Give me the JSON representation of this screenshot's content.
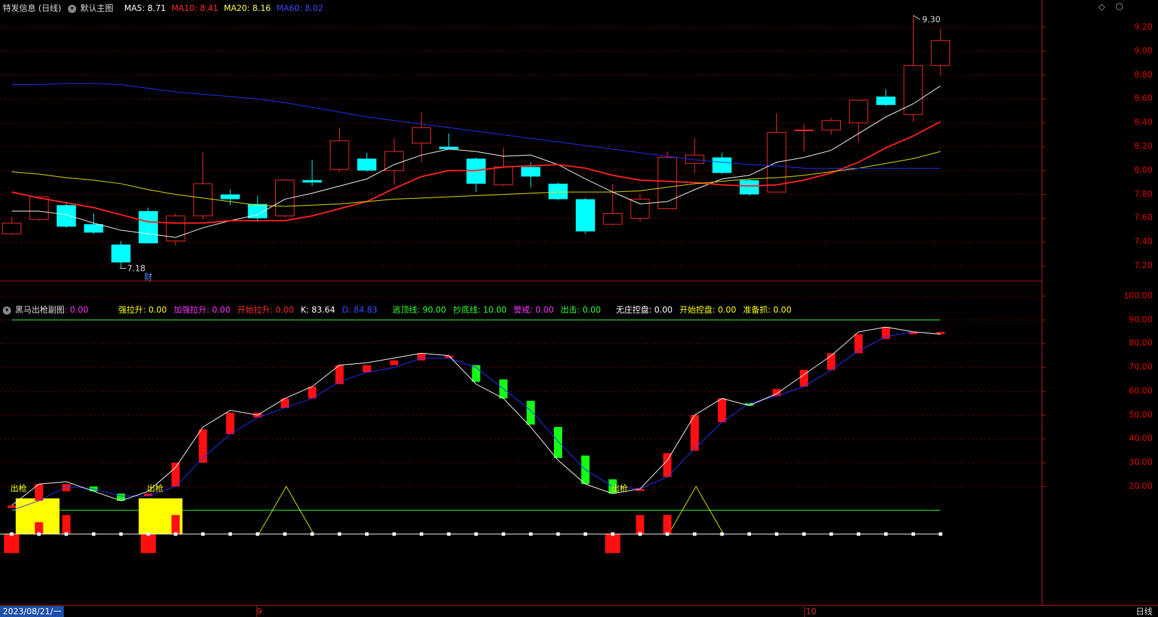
{
  "main_header": {
    "stock_name": "特发信息 (日线)",
    "chart_title": "默认主图",
    "indicators": [
      {
        "label": "MA5: ",
        "value": "8.71",
        "color": "#ffffff"
      },
      {
        "label": "MA10: ",
        "value": "8.41",
        "color": "#ff2a2a"
      },
      {
        "label": "MA20: ",
        "value": "8.16",
        "color": "#ffff55"
      },
      {
        "label": "MA60: ",
        "value": "8.02",
        "color": "#3b4bff"
      }
    ]
  },
  "sub_header": {
    "title": "黑马出枪副图",
    "title_value": ": 0.00",
    "title_value_color": "#ff33ff",
    "items": [
      {
        "label": "强拉升: ",
        "value": "0.00",
        "color": "#ffff00"
      },
      {
        "label": "加强拉升: ",
        "value": "0.00",
        "color": "#ff33ff"
      },
      {
        "label": "开始拉升: ",
        "value": "0.00",
        "color": "#ff2a2a"
      },
      {
        "label": "K: ",
        "value": "83.64",
        "color": "#ffffff"
      },
      {
        "label": "D: ",
        "value": "84.83",
        "color": "#3b4bff"
      },
      {
        "label": "逃顶线: ",
        "value": "90.00",
        "color": "#33ff33"
      },
      {
        "label": "抄底线: ",
        "value": "10.00",
        "color": "#33ff33"
      },
      {
        "label": "警戒: ",
        "value": "0.00",
        "color": "#ff33ff"
      },
      {
        "label": "出击: ",
        "value": "0.00",
        "color": "#33ff33"
      },
      {
        "label": "无庄控盘: ",
        "value": "0.00",
        "color": "#ffffff"
      },
      {
        "label": "开始控盘: ",
        "value": "0.00",
        "color": "#ffff00"
      },
      {
        "label": "准备抓: ",
        "value": "0.00",
        "color": "#ffff00"
      }
    ]
  },
  "main_axis": [
    "9.20",
    "9.00",
    "8.80",
    "8.60",
    "8.40",
    "8.20",
    "8.00",
    "7.80",
    "7.60",
    "7.40",
    "7.20"
  ],
  "sub_axis": [
    "100.00",
    "90.00",
    "80.00",
    "70.00",
    "60.00",
    "50.00",
    "40.00",
    "30.00",
    "20.00"
  ],
  "annotations": {
    "high_label": "9.30",
    "low_label": "7.18",
    "finance_marker": "财",
    "signal_label": "出枪"
  },
  "bottom_bar": {
    "date": "2023/08/21/一",
    "month_labels": [
      "9",
      "10"
    ],
    "period_button": "日线"
  },
  "colors": {
    "up": "#ff2a2a",
    "down": "#00ffff",
    "ma5": "#ffffff",
    "ma10": "#ff2020",
    "ma20": "#e6e600",
    "ma60": "#2233ff",
    "kline": "#ffffff",
    "dline": "#2233ff",
    "limit_lines": "#33ff33",
    "grid": "#8a0000"
  },
  "chart_data": [
    {
      "type": "candlestick",
      "title": "默认主图",
      "ylim": [
        7.12,
        9.3
      ],
      "candles": [
        {
          "o": 7.47,
          "h": 7.61,
          "l": 7.46,
          "c": 7.56
        },
        {
          "o": 7.59,
          "h": 7.78,
          "l": 7.58,
          "c": 7.78
        },
        {
          "o": 7.71,
          "h": 7.74,
          "l": 7.52,
          "c": 7.53
        },
        {
          "o": 7.55,
          "h": 7.64,
          "l": 7.47,
          "c": 7.48
        },
        {
          "o": 7.38,
          "h": 7.41,
          "l": 7.18,
          "c": 7.23
        },
        {
          "o": 7.66,
          "h": 7.69,
          "l": 7.39,
          "c": 7.39
        },
        {
          "o": 7.41,
          "h": 7.64,
          "l": 7.37,
          "c": 7.62
        },
        {
          "o": 7.62,
          "h": 8.15,
          "l": 7.59,
          "c": 7.89
        },
        {
          "o": 7.8,
          "h": 7.84,
          "l": 7.71,
          "c": 7.76
        },
        {
          "o": 7.72,
          "h": 7.79,
          "l": 7.57,
          "c": 7.6
        },
        {
          "o": 7.62,
          "h": 7.93,
          "l": 7.61,
          "c": 7.92
        },
        {
          "o": 7.92,
          "h": 8.09,
          "l": 7.87,
          "c": 7.9
        },
        {
          "o": 8.01,
          "h": 8.36,
          "l": 7.99,
          "c": 8.25
        },
        {
          "o": 8.1,
          "h": 8.15,
          "l": 7.99,
          "c": 8.0
        },
        {
          "o": 8.0,
          "h": 8.27,
          "l": 7.88,
          "c": 8.16
        },
        {
          "o": 8.23,
          "h": 8.49,
          "l": 8.07,
          "c": 8.36
        },
        {
          "o": 8.2,
          "h": 8.31,
          "l": 8.18,
          "c": 8.18
        },
        {
          "o": 8.1,
          "h": 8.11,
          "l": 7.82,
          "c": 7.89
        },
        {
          "o": 7.88,
          "h": 8.19,
          "l": 7.87,
          "c": 8.03
        },
        {
          "o": 8.03,
          "h": 8.07,
          "l": 7.86,
          "c": 7.95
        },
        {
          "o": 7.89,
          "h": 7.9,
          "l": 7.75,
          "c": 7.76
        },
        {
          "o": 7.76,
          "h": 7.77,
          "l": 7.47,
          "c": 7.49
        },
        {
          "o": 7.55,
          "h": 7.89,
          "l": 7.54,
          "c": 7.64
        },
        {
          "o": 7.6,
          "h": 7.8,
          "l": 7.57,
          "c": 7.76
        },
        {
          "o": 7.68,
          "h": 8.16,
          "l": 7.68,
          "c": 8.11
        },
        {
          "o": 8.06,
          "h": 8.27,
          "l": 7.98,
          "c": 8.13
        },
        {
          "o": 8.11,
          "h": 8.15,
          "l": 7.97,
          "c": 7.98
        },
        {
          "o": 7.92,
          "h": 7.93,
          "l": 7.79,
          "c": 7.8
        },
        {
          "o": 7.82,
          "h": 8.48,
          "l": 7.82,
          "c": 8.32
        },
        {
          "o": 8.34,
          "h": 8.39,
          "l": 8.16,
          "c": 8.34
        },
        {
          "o": 8.34,
          "h": 8.44,
          "l": 8.3,
          "c": 8.42
        },
        {
          "o": 8.4,
          "h": 8.59,
          "l": 8.24,
          "c": 8.59
        },
        {
          "o": 8.62,
          "h": 8.68,
          "l": 8.54,
          "c": 8.55
        },
        {
          "o": 8.47,
          "h": 9.3,
          "l": 8.41,
          "c": 8.88
        },
        {
          "o": 8.88,
          "h": 9.19,
          "l": 8.8,
          "c": 9.09
        }
      ],
      "ma_series": [
        {
          "name": "MA5",
          "values": [
            7.66,
            7.66,
            7.63,
            7.56,
            7.5,
            7.47,
            7.44,
            7.52,
            7.58,
            7.63,
            7.76,
            7.81,
            7.87,
            7.93,
            8.05,
            8.13,
            8.18,
            8.16,
            8.12,
            8.13,
            8.05,
            7.93,
            7.82,
            7.72,
            7.74,
            7.84,
            7.93,
            7.96,
            8.07,
            8.11,
            8.17,
            8.31,
            8.45,
            8.56,
            8.71
          ]
        },
        {
          "name": "MA10",
          "values": [
            7.82,
            7.77,
            7.73,
            7.69,
            7.63,
            7.57,
            7.56,
            7.56,
            7.58,
            7.58,
            7.58,
            7.62,
            7.68,
            7.74,
            7.85,
            7.95,
            8.0,
            8.0,
            8.03,
            8.04,
            8.05,
            8.02,
            7.96,
            7.92,
            7.91,
            7.9,
            7.88,
            7.87,
            7.88,
            7.92,
            7.98,
            8.07,
            8.19,
            8.29,
            8.41
          ]
        },
        {
          "name": "MA20",
          "values": [
            7.99,
            7.97,
            7.94,
            7.92,
            7.89,
            7.84,
            7.8,
            7.77,
            7.74,
            7.71,
            7.7,
            7.71,
            7.72,
            7.74,
            7.76,
            7.77,
            7.78,
            7.79,
            7.8,
            7.81,
            7.82,
            7.82,
            7.82,
            7.83,
            7.86,
            7.89,
            7.91,
            7.93,
            7.94,
            7.96,
            7.99,
            8.02,
            8.06,
            8.1,
            8.16
          ]
        },
        {
          "name": "MA60",
          "values": [
            8.72,
            8.72,
            8.73,
            8.73,
            8.72,
            8.69,
            8.66,
            8.64,
            8.62,
            8.6,
            8.57,
            8.53,
            8.49,
            8.45,
            8.42,
            8.39,
            8.36,
            8.33,
            8.3,
            8.27,
            8.24,
            8.21,
            8.18,
            8.15,
            8.12,
            8.09,
            8.07,
            8.05,
            8.04,
            8.02,
            8.02,
            8.02,
            8.02,
            8.02,
            8.02
          ]
        }
      ]
    },
    {
      "type": "line",
      "title": "黑马出枪副图",
      "ylim": [
        -10,
        105
      ],
      "series": [
        {
          "name": "K",
          "values": [
            12,
            21,
            22,
            18,
            14,
            18,
            28,
            45,
            52,
            50,
            57,
            62,
            71,
            72,
            74,
            76,
            75,
            63,
            57,
            45,
            31,
            21,
            17,
            19,
            31,
            50,
            57,
            54,
            59,
            67,
            75,
            85,
            87,
            85,
            84
          ]
        },
        {
          "name": "D",
          "values": [
            10,
            14,
            20,
            19,
            16,
            16,
            20,
            32,
            42,
            49,
            53,
            57,
            64,
            68,
            70,
            74,
            74,
            70,
            61,
            52,
            39,
            27,
            20,
            19,
            24,
            36,
            47,
            55,
            58,
            62,
            69,
            77,
            83,
            85,
            84
          ]
        }
      ],
      "hlines": [
        90,
        10
      ],
      "kd_bars": [
        {
          "v": [
            11,
            12
          ]
        },
        {
          "v": [
            14,
            21
          ]
        },
        {
          "v": [
            18,
            21
          ]
        },
        {
          "v": [
            18,
            20
          ]
        },
        {
          "v": [
            14,
            17
          ]
        },
        {
          "v": [
            16,
            17
          ]
        },
        {
          "v": [
            20,
            30
          ]
        },
        {
          "v": [
            30,
            44
          ]
        },
        {
          "v": [
            42,
            51
          ]
        },
        {
          "v": [
            49,
            51
          ]
        },
        {
          "v": [
            53,
            57
          ]
        },
        {
          "v": [
            57,
            62
          ]
        },
        {
          "v": [
            63,
            71
          ]
        },
        {
          "v": [
            68,
            71
          ]
        },
        {
          "v": [
            71,
            73
          ]
        },
        {
          "v": [
            73,
            76
          ]
        },
        {
          "v": [
            74,
            75
          ]
        },
        {
          "v": [
            64,
            71
          ]
        },
        {
          "v": [
            57,
            65
          ]
        },
        {
          "v": [
            46,
            56
          ]
        },
        {
          "v": [
            32,
            45
          ]
        },
        {
          "v": [
            21,
            33
          ]
        },
        {
          "v": [
            17,
            23
          ]
        },
        {
          "v": [
            19,
            19
          ]
        },
        {
          "v": [
            24,
            34
          ]
        },
        {
          "v": [
            35,
            50
          ]
        },
        {
          "v": [
            47,
            57
          ]
        },
        {
          "v": [
            54,
            55
          ]
        },
        {
          "v": [
            58,
            61
          ]
        },
        {
          "v": [
            62,
            69
          ]
        },
        {
          "v": [
            69,
            76
          ]
        },
        {
          "v": [
            76,
            84
          ]
        },
        {
          "v": [
            82,
            87
          ]
        },
        {
          "v": [
            84,
            85
          ]
        },
        {
          "v": [
            84,
            85
          ]
        }
      ],
      "yellow_blocks": [
        {
          "from": 0.5,
          "to": 1.5,
          "top": 15
        },
        {
          "from": 5,
          "to": 6,
          "top": 15
        }
      ],
      "triangles": [
        {
          "center": 10,
          "peak": 20
        },
        {
          "center": 25,
          "peak": 20
        }
      ],
      "bottom_red_bars": [
        {
          "index": 0,
          "v": [
            0,
            -8
          ]
        },
        {
          "index": 1,
          "v": [
            0,
            5
          ]
        },
        {
          "index": 2,
          "v": [
            0,
            8
          ]
        },
        {
          "index": 5,
          "v": [
            0,
            -8
          ]
        },
        {
          "index": 6,
          "v": [
            0,
            8
          ]
        },
        {
          "index": 22,
          "v": [
            0,
            -8
          ]
        },
        {
          "index": 23,
          "v": [
            0,
            8
          ]
        },
        {
          "index": 24,
          "v": [
            0,
            8
          ]
        }
      ],
      "signal_markers": [
        0,
        5,
        22
      ]
    }
  ]
}
